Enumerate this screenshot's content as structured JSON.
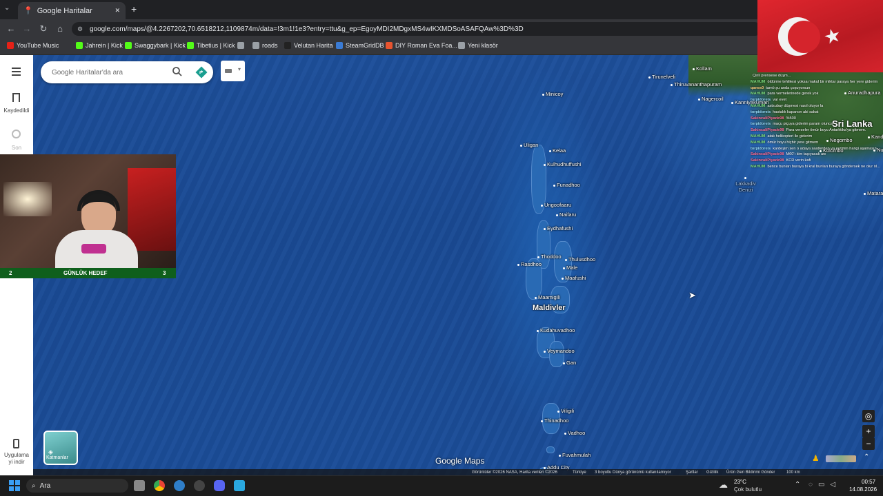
{
  "browser": {
    "tab_title": "Google Haritalar",
    "tab_close": "✕",
    "new_tab": "+",
    "url": "google.com/maps/@4.2267202,70.6518212,1109874m/data=!3m1!1e3?entry=ttu&g_ep=EgoyMDI2MDgxMS4wIKXMDSoASAFQAw%3D%3D",
    "bookmarks": [
      {
        "label": "YouTube Music",
        "color": "#e62117"
      },
      {
        "label": "Jahrein | Kick",
        "color": "#53fc18"
      },
      {
        "label": "Swaggybark | Kick",
        "color": "#53fc18"
      },
      {
        "label": "Tibetius | Kick",
        "color": "#53fc18"
      },
      {
        "label": "",
        "color": "#9aa0a6"
      },
      {
        "label": "roads",
        "color": "#9aa0a6"
      },
      {
        "label": "Velutan Harita",
        "color": "#222222"
      },
      {
        "label": "SteamGridDB",
        "color": "#3a7bd5"
      },
      {
        "label": "DIY Roman Eva Foa...",
        "color": "#e8542f"
      },
      {
        "label": "Yeni klasör",
        "color": "#9aa0a6"
      }
    ]
  },
  "maps": {
    "search_placeholder": "Google Haritalar'da ara",
    "rail": {
      "saved": "Kaydedildi",
      "recent": "Son",
      "get_app_line1": "Uygulama",
      "get_app_line2": "yi indir"
    },
    "layers_label": "Katmanlar",
    "brand": "Google Maps",
    "places": [
      {
        "name": "Minicoy",
        "bold": false
      },
      {
        "name": "Uligan",
        "bold": false
      },
      {
        "name": "Kelaa",
        "bold": false
      },
      {
        "name": "Kulhudhuffushi",
        "bold": false
      },
      {
        "name": "Funadhoo",
        "bold": false
      },
      {
        "name": "Ungoofaaru",
        "bold": false
      },
      {
        "name": "Naifaru",
        "bold": false
      },
      {
        "name": "Eydhafushi",
        "bold": false
      },
      {
        "name": "Thoddoo",
        "bold": false
      },
      {
        "name": "Thulusdhoo",
        "bold": false
      },
      {
        "name": "Rasdhoo",
        "bold": false
      },
      {
        "name": "Male",
        "bold": false
      },
      {
        "name": "Maafushi",
        "bold": false
      },
      {
        "name": "Maamigili",
        "bold": false
      },
      {
        "name": "Maldivler",
        "bold": true
      },
      {
        "name": "Kudahuvadhoo",
        "bold": false
      },
      {
        "name": "Veymandoo",
        "bold": false
      },
      {
        "name": "Gan",
        "bold": false
      },
      {
        "name": "Viligili",
        "bold": false
      },
      {
        "name": "Thinadhoo",
        "bold": false
      },
      {
        "name": "Vadhoo",
        "bold": false
      },
      {
        "name": "Fuvahmulah",
        "bold": false
      },
      {
        "name": "Addu City",
        "bold": false
      },
      {
        "name": "Kollam",
        "bold": false
      },
      {
        "name": "Tirunelveli",
        "bold": false
      },
      {
        "name": "Thiruvananthapuram",
        "bold": false
      },
      {
        "name": "Nagercoil",
        "bold": false
      },
      {
        "name": "Kanniyakumari",
        "bold": false
      },
      {
        "name": "Anuradhapura",
        "bold": false
      },
      {
        "name": "Sri Lanka",
        "bold": true
      },
      {
        "name": "Negombo",
        "bold": false
      },
      {
        "name": "Kolombo",
        "bold": false
      },
      {
        "name": "Kandy",
        "bold": false
      },
      {
        "name": "Nuwara",
        "bold": false
      },
      {
        "name": "Lakkadiv Denizi",
        "bold": false
      },
      {
        "name": "Matara",
        "bold": false
      }
    ],
    "footer": [
      "Görüntüler ©2026 NASA, Harita verileri ©2026",
      "Türkiye",
      "3 boyutlu Dünya görünümü kullanılamıyor",
      "Şartlar",
      "Gizlilik",
      "Ürün Geri Bildirimi Gönder",
      "100 km"
    ]
  },
  "stream": {
    "goal_left": "2",
    "goal_label": "GÜNLÜK HEDEF",
    "goal_right": "3",
    "chat": [
      {
        "user": "",
        "text": "Çinli prensese düşm..."
      },
      {
        "user": "MAHUM",
        "text": "öldürme tehlikesi yoksa makul bir miktar paraya her yere giderim"
      },
      {
        "user": "qanes0",
        "text": "tamö şu anda çoşuyorsun"
      },
      {
        "user": "MAHUM",
        "text": "para vermelerinede gerek yok"
      },
      {
        "user": "torpidoreis",
        "text": "var evet"
      },
      {
        "user": "MAHUM",
        "text": "astsubay düşmesi nasıl oluyor la"
      },
      {
        "user": "torpidoreis",
        "text": "hastalık kaparsın abi sakat"
      },
      {
        "user": "SakincaliPiyade98",
        "text": "%500"
      },
      {
        "user": "torpidoreis",
        "text": "maçu piçuya giderim param olunca"
      },
      {
        "user": "SakincaliPiyade98",
        "text": "Para verseler ömür boyu Antarktika'ya gitmem."
      },
      {
        "user": "MAHUM",
        "text": "atak helikopteri ile giderim"
      },
      {
        "user": "MAHUM",
        "text": "ömür boyu hiçbir yere gitmem"
      },
      {
        "user": "torpidoreis",
        "text": "kardeşim sen o adaya saatlerden ya evrimin hangi aşamasında geçtin oraya ya"
      },
      {
        "user": "SakincaliPiyade98",
        "text": "M60'ı kim taşıyacak aw"
      },
      {
        "user": "SakincaliPiyade98",
        "text": "KCR verin kafi"
      },
      {
        "user": "MAHUM",
        "text": "bence bunları buraya bi kral bunları buraya göndersek ne olur ölü biraktı"
      }
    ]
  },
  "taskbar": {
    "search": "Ara",
    "weather_temp": "23°C",
    "weather_desc": "Çok bulutlu",
    "time": "00:57",
    "date": "14.08.2026"
  },
  "colors": {
    "accent": "#1a73e8",
    "goal_bar": "#0f5f1c",
    "ocean": "#1b4d98"
  }
}
